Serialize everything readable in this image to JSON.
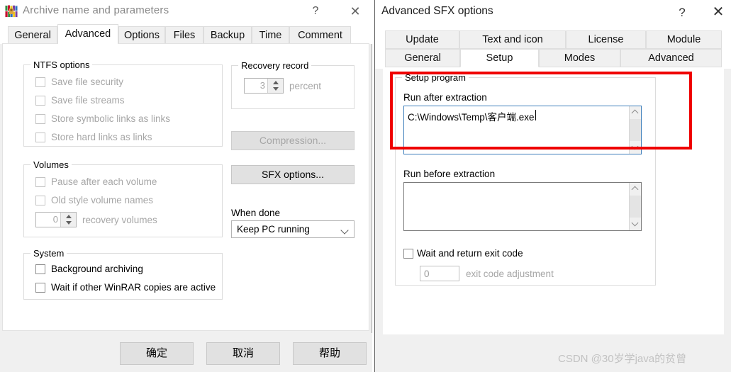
{
  "left_dialog": {
    "title": "Archive name and parameters",
    "icon": "winrar-books-icon",
    "titlebar_buttons": {
      "help": "?",
      "close": "✕"
    },
    "tabs": [
      {
        "label": "General",
        "active": false
      },
      {
        "label": "Advanced",
        "active": true
      },
      {
        "label": "Options",
        "active": false
      },
      {
        "label": "Files",
        "active": false
      },
      {
        "label": "Backup",
        "active": false
      },
      {
        "label": "Time",
        "active": false
      },
      {
        "label": "Comment",
        "active": false
      }
    ],
    "ntfs_group": {
      "legend": "NTFS options",
      "items": [
        {
          "label": "Save file security",
          "checked": false,
          "disabled": true
        },
        {
          "label": "Save file streams",
          "checked": false,
          "disabled": true
        },
        {
          "label": "Store symbolic links as links",
          "checked": false,
          "disabled": true
        },
        {
          "label": "Store hard links as links",
          "checked": false,
          "disabled": true
        }
      ]
    },
    "volumes_group": {
      "legend": "Volumes",
      "items": [
        {
          "label": "Pause after each volume",
          "checked": false,
          "disabled": true
        },
        {
          "label": "Old style volume names",
          "checked": false,
          "disabled": true
        }
      ],
      "recovery_volumes": {
        "value": "0",
        "label": "recovery volumes",
        "disabled": true
      }
    },
    "system_group": {
      "legend": "System",
      "items": [
        {
          "label": "Background archiving",
          "checked": false,
          "disabled": false
        },
        {
          "label": "Wait if other WinRAR copies are active",
          "checked": false,
          "disabled": false
        }
      ]
    },
    "recovery_record_group": {
      "legend": "Recovery record",
      "value": "3",
      "unit_label": "percent",
      "disabled": true
    },
    "compression_button": {
      "label": "Compression...",
      "disabled": true
    },
    "sfx_options_button": {
      "label": "SFX options...",
      "disabled": false
    },
    "when_done": {
      "label": "When done",
      "selected": "Keep PC running"
    },
    "footer_buttons": [
      {
        "label": "确定",
        "name": "ok-button"
      },
      {
        "label": "取消",
        "name": "cancel-button"
      },
      {
        "label": "帮助",
        "name": "help-button"
      }
    ]
  },
  "right_dialog": {
    "title": "Advanced SFX options",
    "titlebar_buttons": {
      "help": "?",
      "close": "✕"
    },
    "tabs_row1": [
      {
        "label": "Update",
        "active": false
      },
      {
        "label": "Text and icon",
        "active": false
      },
      {
        "label": "License",
        "active": false
      },
      {
        "label": "Module",
        "active": false
      }
    ],
    "tabs_row2": [
      {
        "label": "General",
        "active": false
      },
      {
        "label": "Setup",
        "active": true
      },
      {
        "label": "Modes",
        "active": false
      },
      {
        "label": "Advanced",
        "active": false
      }
    ],
    "setup_group": {
      "legend": "Setup program",
      "run_after_label": "Run after extraction",
      "run_after_value": "C:\\Windows\\Temp\\客户端.exe",
      "run_before_label": "Run before extraction",
      "run_before_value": "",
      "wait_exit_code": {
        "label": "Wait and return exit code",
        "checked": false
      },
      "exit_code_adjustment": {
        "value": "0",
        "label": "exit code adjustment",
        "disabled": true
      }
    },
    "highlight_color": "#ef0000"
  },
  "watermark": {
    "text": "CSDN @30岁学java的贫曾"
  }
}
